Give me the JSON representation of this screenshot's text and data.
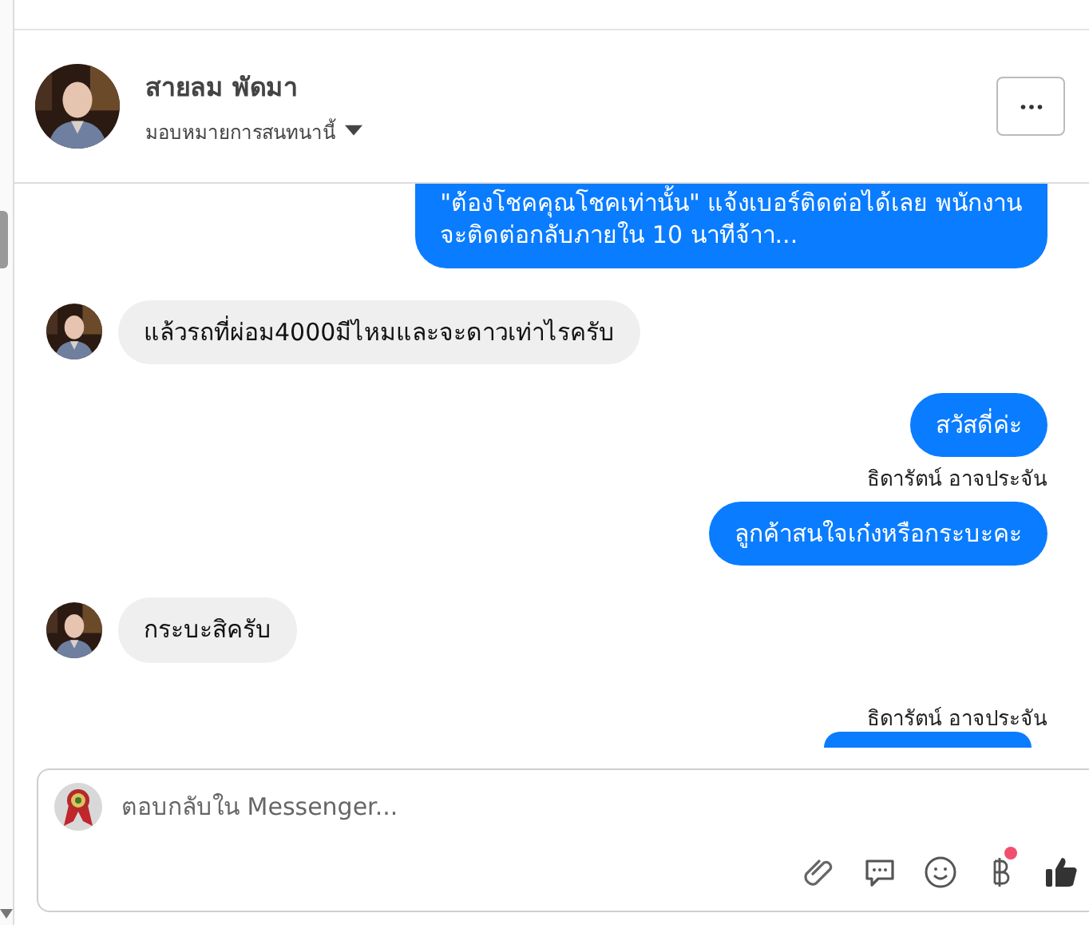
{
  "header": {
    "name": "สายลม พัดมา",
    "subtitle": "มอบหมายการสนทนานี้"
  },
  "messages": [
    {
      "kind": "outgoing",
      "text": "\"ต้องโชคคุณโชคเท่านั้น\" แจ้งเบอร์ติดต่อได้เลย พนักงาน\nจะติดต่อกลับภายใน 10 นาทีจ้าา...",
      "cut_top": true
    },
    {
      "kind": "incoming",
      "text": "แล้วรถที่ผ่อม4000มีไหมและจะดาวเท่าไรครับ"
    },
    {
      "kind": "outgoing",
      "text": "สวัสดี่ค่ะ"
    },
    {
      "kind": "sender",
      "text": "ธิดารัตน์ อาจประจัน"
    },
    {
      "kind": "outgoing",
      "text": "ลูกค้าสนใจเก๋งหรือกระบะคะ"
    },
    {
      "kind": "incoming",
      "text": "กระบะสิครับ"
    },
    {
      "kind": "sender",
      "text": "ธิดารัตน์ อาจประจัน"
    },
    {
      "kind": "cut"
    }
  ],
  "composer": {
    "placeholder": "ตอบกลับใน Messenger...",
    "payment_badge": true
  }
}
